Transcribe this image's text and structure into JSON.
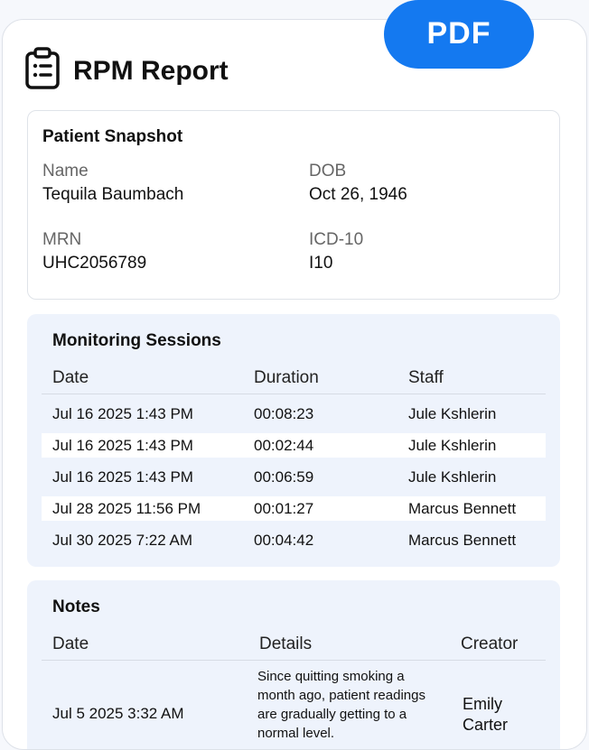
{
  "actions": {
    "pdf_label": "PDF"
  },
  "header": {
    "title": "RPM Report",
    "icon": "clipboard-icon"
  },
  "snapshot": {
    "title": "Patient Snapshot",
    "name_label": "Name",
    "name_value": "Tequila Baumbach",
    "dob_label": "DOB",
    "dob_value": "Oct 26, 1946",
    "mrn_label": "MRN",
    "mrn_value": "UHC2056789",
    "icd_label": "ICD-10",
    "icd_value": "I10"
  },
  "sessions": {
    "title": "Monitoring Sessions",
    "columns": [
      "Date",
      "Duration",
      "Staff"
    ],
    "rows": [
      {
        "date": "Jul 16 2025 1:43 PM",
        "duration": "00:08:23",
        "staff": "Jule Kshlerin"
      },
      {
        "date": "Jul 16 2025 1:43 PM",
        "duration": "00:02:44",
        "staff": "Jule Kshlerin"
      },
      {
        "date": "Jul 16 2025 1:43 PM",
        "duration": "00:06:59",
        "staff": "Jule Kshlerin"
      },
      {
        "date": "Jul 28 2025 11:56 PM",
        "duration": "00:01:27",
        "staff": "Marcus Bennett"
      },
      {
        "date": "Jul 30 2025 7:22 AM",
        "duration": "00:04:42",
        "staff": "Marcus Bennett"
      }
    ]
  },
  "notes": {
    "title": "Notes",
    "columns": [
      "Date",
      "Details",
      "Creator"
    ],
    "rows": [
      {
        "date": "Jul 5 2025 3:32 AM",
        "details": "Since quitting smoking a month ago, patient readings are gradually getting to a normal level.",
        "creator": "Emily Carter"
      }
    ]
  },
  "colors": {
    "accent": "#1479f0",
    "panel": "#eef3fc"
  }
}
